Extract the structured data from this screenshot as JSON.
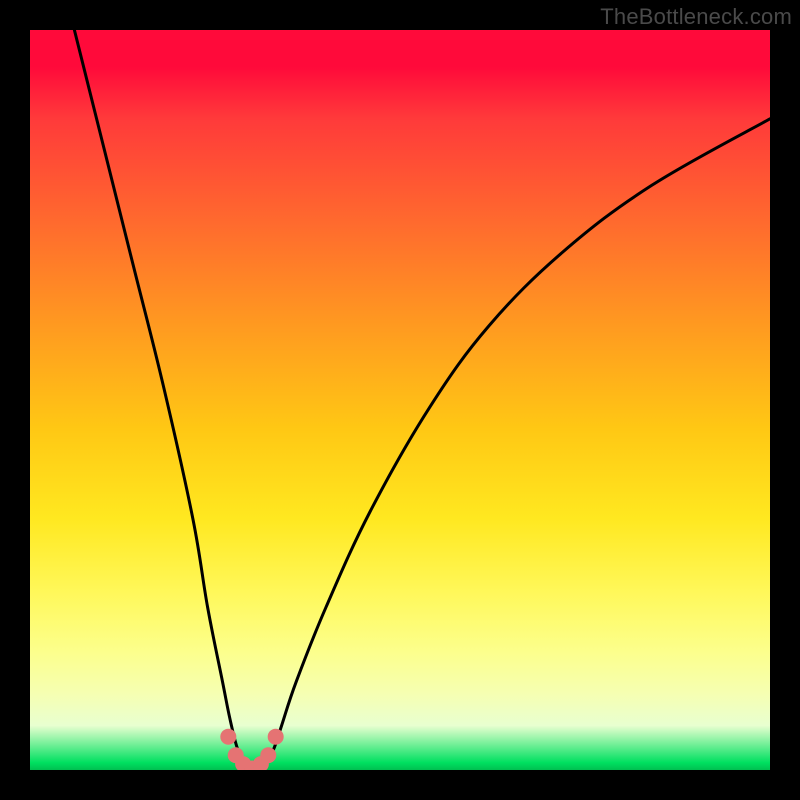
{
  "watermark": "TheBottleneck.com",
  "chart_data": {
    "type": "line",
    "title": "",
    "xlabel": "",
    "ylabel": "",
    "xlim": [
      0,
      100
    ],
    "ylim": [
      0,
      100
    ],
    "grid": false,
    "legend": false,
    "series": [
      {
        "name": "bottleneck-curve",
        "x": [
          6,
          10,
          14,
          18,
          22,
          24,
          26,
          27,
          28,
          29,
          30,
          31,
          32,
          33,
          34,
          36,
          40,
          46,
          54,
          62,
          72,
          84,
          100
        ],
        "y": [
          100,
          84,
          68,
          52,
          34,
          22,
          12,
          7,
          3,
          1,
          0,
          0,
          1,
          3,
          6,
          12,
          22,
          35,
          49,
          60,
          70,
          79,
          88
        ]
      },
      {
        "name": "trough-markers",
        "x": [
          26.8,
          27.8,
          28.8,
          30.0,
          31.2,
          32.2,
          33.2
        ],
        "y": [
          4.5,
          2.0,
          0.8,
          0.2,
          0.8,
          2.0,
          4.5
        ]
      }
    ],
    "background": {
      "type": "vertical-gradient",
      "stops": [
        {
          "pos": 0.0,
          "color": "#ff0a3a"
        },
        {
          "pos": 0.4,
          "color": "#ff9a20"
        },
        {
          "pos": 0.7,
          "color": "#ffe820"
        },
        {
          "pos": 0.92,
          "color": "#f5ffb4"
        },
        {
          "pos": 1.0,
          "color": "#00c050"
        }
      ]
    },
    "curve_color": "#000000",
    "marker_color": "#e57373"
  }
}
